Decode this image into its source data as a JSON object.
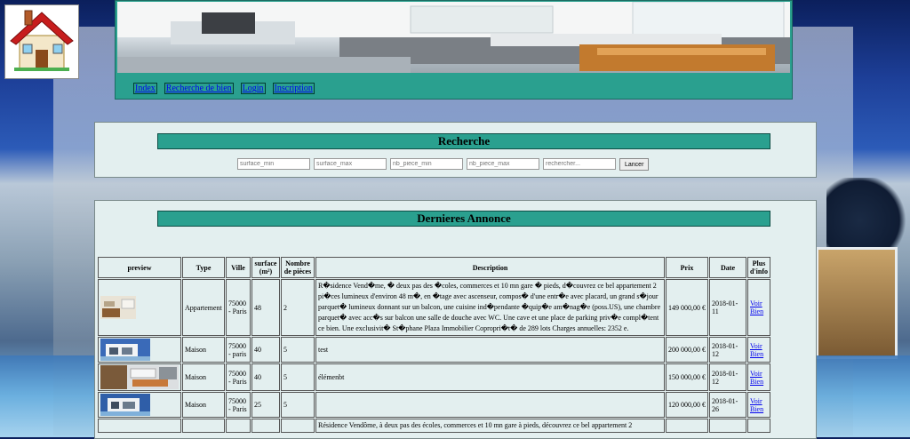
{
  "nav": {
    "items": [
      {
        "label": "Index"
      },
      {
        "label": "Recherche de bien"
      },
      {
        "label": "Login"
      },
      {
        "label": "Inscription"
      }
    ]
  },
  "search": {
    "title": "Recherche",
    "fields": [
      {
        "placeholder": "surface_min"
      },
      {
        "placeholder": "surface_max"
      },
      {
        "placeholder": "nb_piece_min"
      },
      {
        "placeholder": "nb_piece_max"
      },
      {
        "placeholder": "rechercher..."
      }
    ],
    "submit_label": "Lancer"
  },
  "annonces": {
    "title": "Dernieres Annonce",
    "headers": {
      "preview": "preview",
      "type": "Type",
      "ville": "Ville",
      "surface": "surface (m²)",
      "pieces": "Nombre de pièces",
      "description": "Description",
      "prix": "Prix",
      "date": "Date",
      "plus": "Plus d'info"
    },
    "rows": [
      {
        "type": "Appartement",
        "ville": "75000 - Paris",
        "surface": "48",
        "pieces": "2",
        "description": "R�sidence Vend�me, � deux pas des �coles, commerces et 10 mn gare � pieds, d�couvrez ce bel appartement 2 pi�ces lumineux d'environ 48 m�, en �tage avec ascenseur, compos� d'une entr�e avec placard, un grand s�jour parquet� lumineux donnant sur un balcon, une cuisine ind�pendante �quip�e am�nag�e (poss.US), une chambre parquet� avec acc�s sur balcon une salle de douche avec WC. Une cave et une place de parking priv�e compl�tent ce bien. Une exclusivit� St�phane Plaza Immobilier Copropri�t� de 289 lots Charges annuelles: 2352 e.",
        "prix": "149 000,00 €",
        "date": "2018-01-11",
        "link": "Voir Bien"
      },
      {
        "type": "Maison",
        "ville": "75000 - paris",
        "surface": "40",
        "pieces": "5",
        "description": "test",
        "prix": "200 000,00 €",
        "date": "2018-01-12",
        "link": "Voir Bien"
      },
      {
        "type": "Maison",
        "ville": "75000 - Paris",
        "surface": "40",
        "pieces": "5",
        "description": "élémenbt",
        "prix": "150 000,00 €",
        "date": "2018-01-12",
        "link": "Voir Bien"
      },
      {
        "type": "Maison",
        "ville": "75000 - Paris",
        "surface": "25",
        "pieces": "5",
        "description": "",
        "prix": "120 000,00 €",
        "date": "2018-01-26",
        "link": "Voir Bien"
      },
      {
        "type": "",
        "ville": "",
        "surface": "",
        "pieces": "",
        "description": "Résidence Vendôme, à deux pas des écoles, commerces et 10 mn gare à pieds, découvrez ce bel appartement 2",
        "prix": "",
        "date": "",
        "link": ""
      }
    ]
  }
}
